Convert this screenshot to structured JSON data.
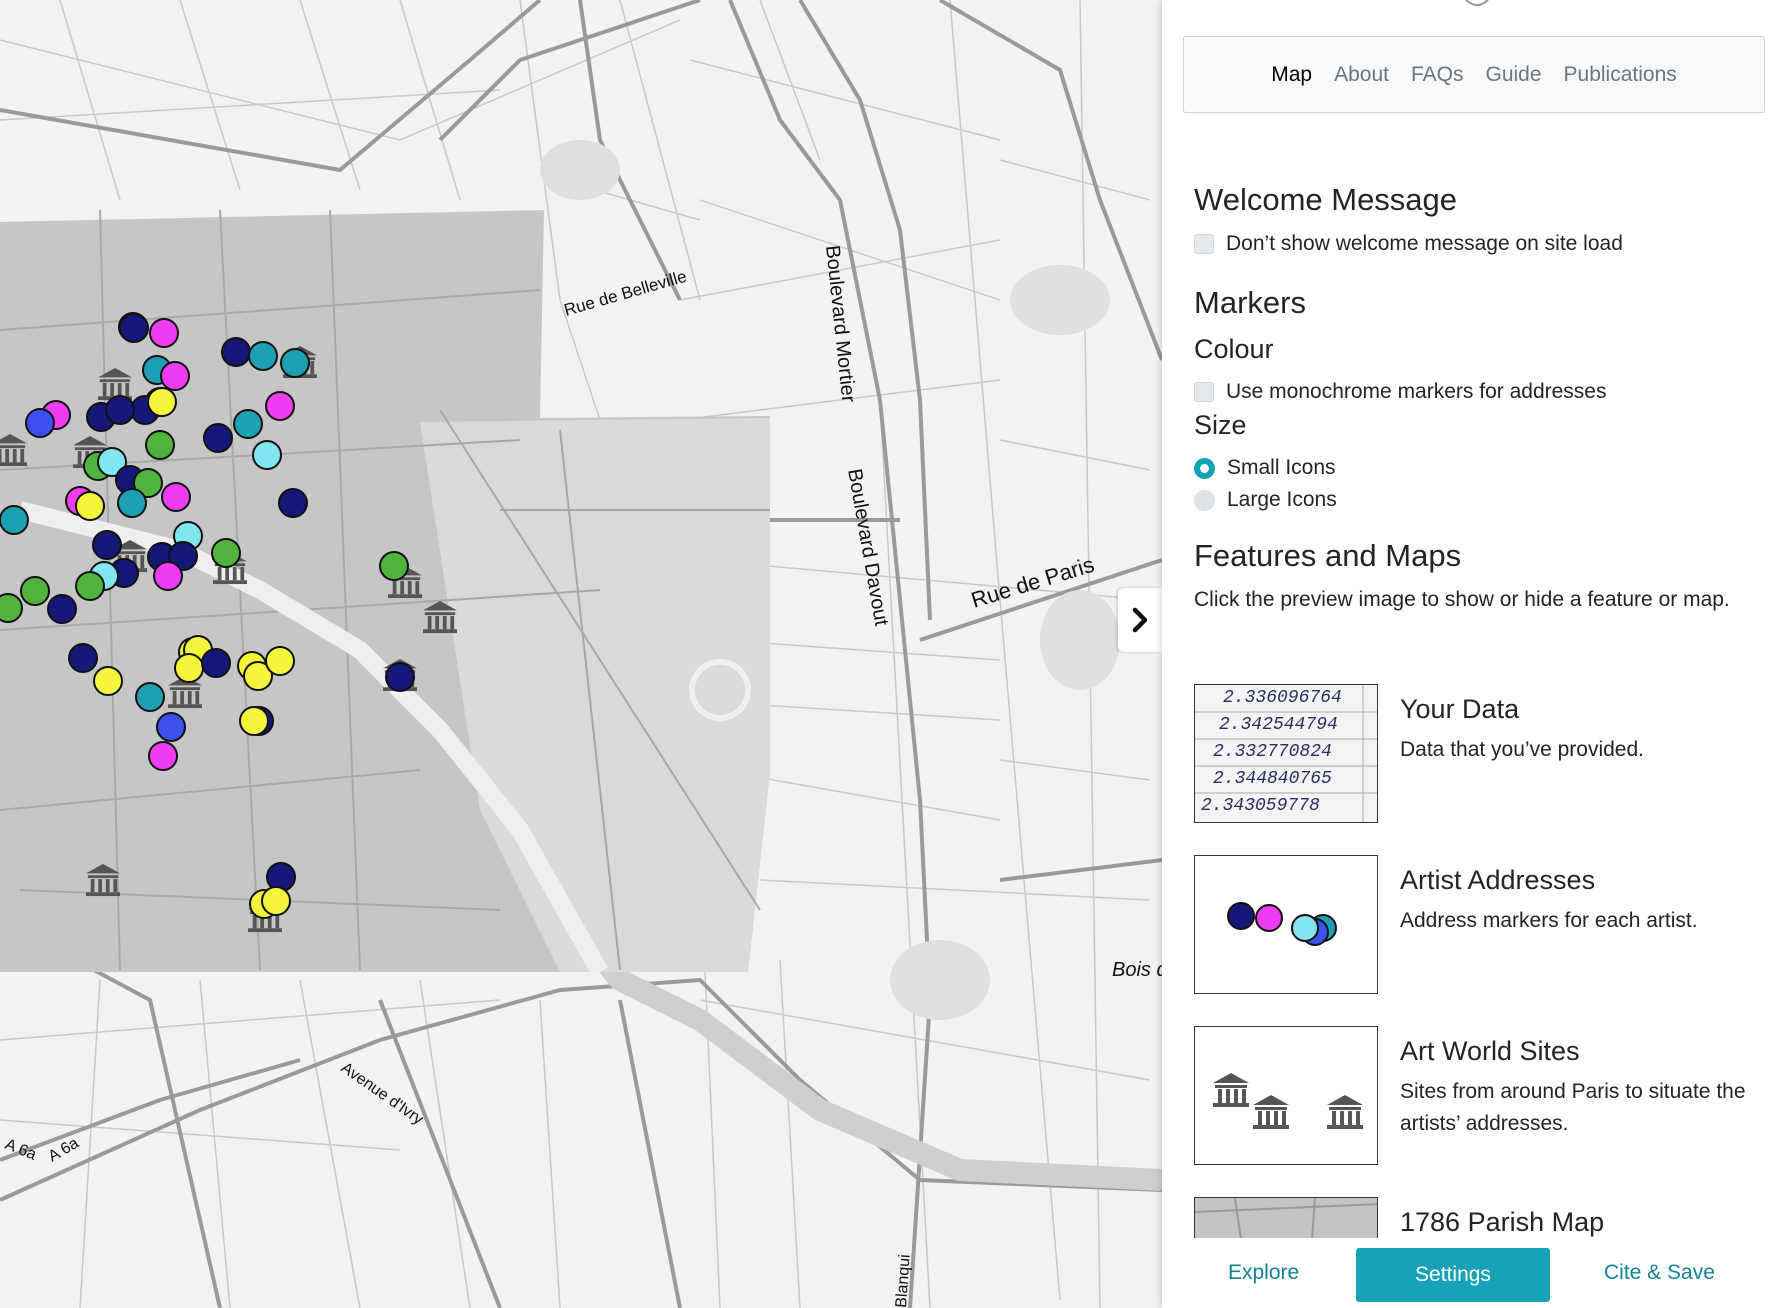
{
  "nav": {
    "items": [
      {
        "label": "Map",
        "active": true
      },
      {
        "label": "About",
        "active": false
      },
      {
        "label": "FAQs",
        "active": false
      },
      {
        "label": "Guide",
        "active": false
      },
      {
        "label": "Publications",
        "active": false
      }
    ]
  },
  "welcome": {
    "heading": "Welcome Message",
    "checkbox_label": "Don’t show welcome message on site load",
    "checked": false
  },
  "markers": {
    "heading": "Markers",
    "colour_heading": "Colour",
    "monochrome_label": "Use monochrome markers for addresses",
    "monochrome_checked": false,
    "size_heading": "Size",
    "size_options": [
      {
        "label": "Small Icons",
        "selected": true
      },
      {
        "label": "Large Icons",
        "selected": false
      }
    ]
  },
  "features": {
    "heading": "Features and Maps",
    "intro": "Click the preview image to show or hide a feature or map.",
    "items": [
      {
        "title": "Your Data",
        "description": "Data that you’ve provided.",
        "thumb": "data-values",
        "thumb_values": [
          "2.336096764",
          "2.342544794",
          "2.332770824",
          "2.344840765",
          "2.343059778"
        ]
      },
      {
        "title": "Artist Addresses",
        "description": "Address markers for each artist.",
        "thumb": "marker-cluster"
      },
      {
        "title": "Art World Sites",
        "description": "Sites from around Paris to situate the artists’ addresses.",
        "thumb": "museum-icons"
      },
      {
        "title": "1786 Parish Map",
        "description": "",
        "thumb": "parish-map"
      }
    ]
  },
  "footer": {
    "explore": "Explore",
    "settings": "Settings",
    "cite": "Cite & Save"
  },
  "map": {
    "labels": {
      "rue_belleville": "Rue de Belleville",
      "bd_mortier": "Boulevard Mortier",
      "bd_davout": "Boulevard Davout",
      "rue_paris": "Rue de Paris",
      "bois": "Bois d",
      "avenue_ivry": "Avenue d'Ivry",
      "a6a_1": "A 6a",
      "a6a_2": "A 6a",
      "blanqui": "Blanqui"
    },
    "marker_colors": {
      "navy": "#141878",
      "magenta": "#f03cf0",
      "yellow": "#f5f53c",
      "green": "#50b43c",
      "teal": "#1ea0b4",
      "lightcyan": "#82e6f0",
      "blue": "#3c50f0"
    },
    "toggle_icon": "chevron-right-icon"
  },
  "colors": {
    "accent": "#17a2b8",
    "link": "#138496"
  }
}
